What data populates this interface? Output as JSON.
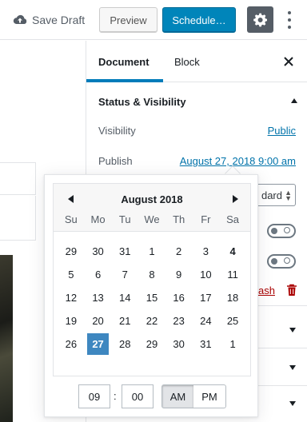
{
  "toolbar": {
    "save_draft": "Save Draft",
    "preview": "Preview",
    "schedule": "Schedule…"
  },
  "sidebar": {
    "tabs": [
      "Document",
      "Block"
    ],
    "status_panel": {
      "title": "Status & Visibility",
      "visibility_label": "Visibility",
      "visibility_value": "Public",
      "publish_label": "Publish",
      "publish_value": "August 27, 2018 9:00 am",
      "post_format_value": "dard",
      "trash_partial": "ash"
    }
  },
  "datepicker": {
    "month_title": "August 2018",
    "weekdays": [
      "Su",
      "Mo",
      "Tu",
      "We",
      "Th",
      "Fr",
      "Sa"
    ],
    "days": [
      {
        "n": "29",
        "outside": true
      },
      {
        "n": "30",
        "outside": true
      },
      {
        "n": "31",
        "outside": true
      },
      {
        "n": "1"
      },
      {
        "n": "2"
      },
      {
        "n": "3"
      },
      {
        "n": "4",
        "today": true
      },
      {
        "n": "5"
      },
      {
        "n": "6"
      },
      {
        "n": "7"
      },
      {
        "n": "8"
      },
      {
        "n": "9"
      },
      {
        "n": "10"
      },
      {
        "n": "11"
      },
      {
        "n": "12"
      },
      {
        "n": "13"
      },
      {
        "n": "14"
      },
      {
        "n": "15"
      },
      {
        "n": "16"
      },
      {
        "n": "17"
      },
      {
        "n": "18"
      },
      {
        "n": "19"
      },
      {
        "n": "20"
      },
      {
        "n": "21"
      },
      {
        "n": "22"
      },
      {
        "n": "23"
      },
      {
        "n": "24"
      },
      {
        "n": "25"
      },
      {
        "n": "26"
      },
      {
        "n": "27",
        "selected": true
      },
      {
        "n": "28"
      },
      {
        "n": "29"
      },
      {
        "n": "30"
      },
      {
        "n": "31"
      },
      {
        "n": "1",
        "outside": true
      }
    ],
    "hour": "09",
    "minute": "00",
    "time_sep": ":",
    "am": "AM",
    "pm": "PM"
  },
  "colors": {
    "primary": "#0085ba",
    "link": "#0073aa",
    "selected_day": "#3e87c0",
    "trash": "#a00"
  },
  "icons": [
    "cloud-upload-icon",
    "gear-icon",
    "more-vertical-icon",
    "close-icon",
    "chevron-up-icon",
    "chevron-down-icon",
    "trash-icon",
    "arrow-left-icon",
    "arrow-right-icon"
  ]
}
